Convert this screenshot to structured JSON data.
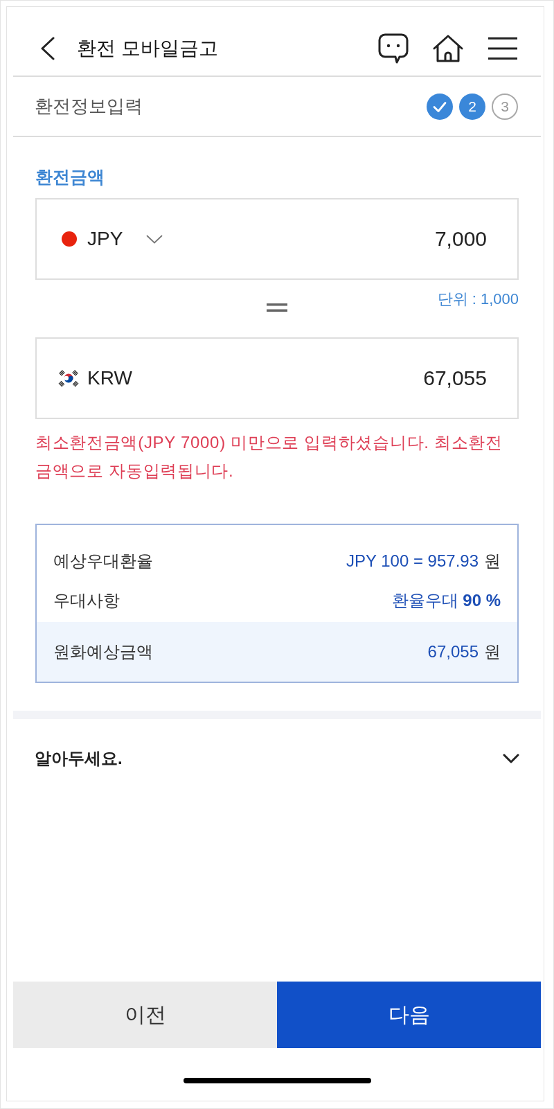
{
  "header": {
    "title": "환전 모바일금고"
  },
  "progress": {
    "title": "환전정보입력",
    "steps": [
      {
        "completed": true,
        "current": false
      },
      {
        "label": "2",
        "completed": false,
        "current": true
      },
      {
        "label": "3",
        "completed": false,
        "current": false
      }
    ]
  },
  "exchange": {
    "label": "환전금액",
    "from": {
      "currency": "JPY",
      "amount": "7,000"
    },
    "unit_note": "단위 : 1,000",
    "to": {
      "currency": "KRW",
      "amount": "67,055"
    },
    "error": "최소환전금액(JPY 7000) 미만으로 입력하셨습니다. 최소환전금액으로 자동입력됩니다."
  },
  "summary": {
    "rows": [
      {
        "label": "예상우대환율",
        "value": "JPY 100 = 957.93",
        "unit": "원"
      },
      {
        "label": "우대사항",
        "value": "환율우대 **90 %**"
      }
    ],
    "total": {
      "label": "원화예상금액",
      "value": "67,055",
      "unit": "원"
    }
  },
  "notice": {
    "title": "알아두세요.",
    "expanded": false
  },
  "buttons": [
    {
      "label": "이전",
      "kind": "secondary"
    },
    {
      "label": "다음",
      "kind": "primary"
    }
  ]
}
